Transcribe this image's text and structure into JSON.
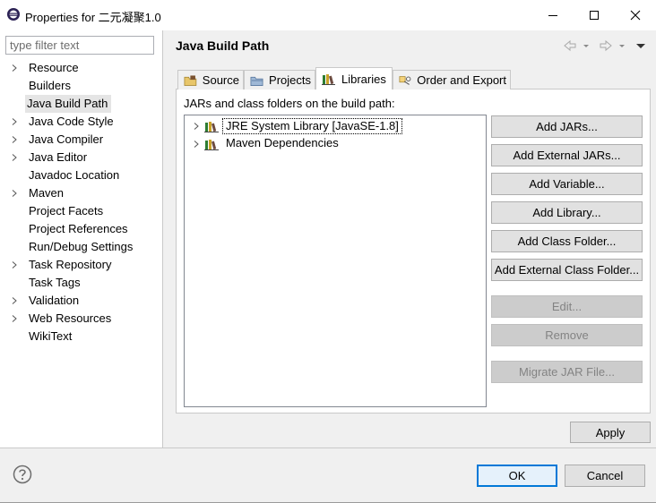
{
  "window": {
    "title": "Properties for 二元凝聚1.0",
    "minimize": "minimize",
    "maximize": "maximize",
    "close": "close"
  },
  "filter": {
    "placeholder": "type filter text",
    "value": ""
  },
  "nav": {
    "items": [
      {
        "label": "Resource",
        "expandable": true
      },
      {
        "label": "Builders",
        "expandable": false
      },
      {
        "label": "Java Build Path",
        "expandable": false,
        "selected": true
      },
      {
        "label": "Java Code Style",
        "expandable": true
      },
      {
        "label": "Java Compiler",
        "expandable": true
      },
      {
        "label": "Java Editor",
        "expandable": true
      },
      {
        "label": "Javadoc Location",
        "expandable": false
      },
      {
        "label": "Maven",
        "expandable": true
      },
      {
        "label": "Project Facets",
        "expandable": false
      },
      {
        "label": "Project References",
        "expandable": false
      },
      {
        "label": "Run/Debug Settings",
        "expandable": false
      },
      {
        "label": "Task Repository",
        "expandable": true
      },
      {
        "label": "Task Tags",
        "expandable": false
      },
      {
        "label": "Validation",
        "expandable": true
      },
      {
        "label": "Web Resources",
        "expandable": true
      },
      {
        "label": "WikiText",
        "expandable": false
      }
    ]
  },
  "page": {
    "title": "Java Build Path"
  },
  "tabs": [
    {
      "label": "Source",
      "icon": "source-folder-icon",
      "active": false
    },
    {
      "label": "Projects",
      "icon": "projects-folder-icon",
      "active": false
    },
    {
      "label": "Libraries",
      "icon": "libraries-icon",
      "active": true
    },
    {
      "label": "Order and Export",
      "icon": "order-export-icon",
      "active": false
    }
  ],
  "libraries": {
    "heading": "JARs and class folders on the build path:",
    "entries": [
      {
        "label": "JRE System Library [JavaSE-1.8]",
        "icon": "library-icon"
      },
      {
        "label": "Maven Dependencies",
        "icon": "library-icon"
      }
    ]
  },
  "buttons": {
    "add_jars": "Add JARs...",
    "add_external_jars": "Add External JARs...",
    "add_variable": "Add Variable...",
    "add_library": "Add Library...",
    "add_class_folder": "Add Class Folder...",
    "add_external_class_folder": "Add External Class Folder...",
    "edit": "Edit...",
    "remove": "Remove",
    "migrate_jar": "Migrate JAR File...",
    "apply": "Apply",
    "ok": "OK",
    "cancel": "Cancel"
  },
  "colors": {
    "selection": "#e5e5e5",
    "button_face": "#e1e1e1",
    "default_button_border": "#0078d7",
    "disabled_text": "#838383"
  }
}
